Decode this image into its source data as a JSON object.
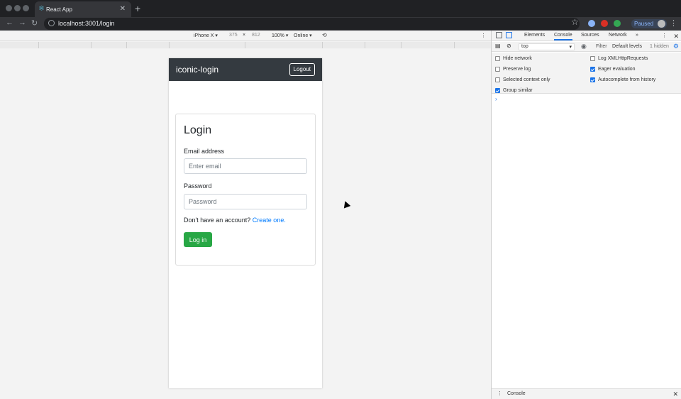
{
  "browser": {
    "tab_title": "React App",
    "tab_close": "✕",
    "new_tab": "+",
    "url": "localhost:3001/login",
    "back": "←",
    "forward": "→",
    "reload": "↻",
    "bookmark": "☆",
    "profile_label": "Paused",
    "menu": "⋮"
  },
  "device_toolbar": {
    "device": "iPhone X ▾",
    "width": "375",
    "times": "×",
    "height": "812",
    "zoom": "100% ▾",
    "network": "Online ▾",
    "more": "⋮"
  },
  "app": {
    "brand": "iconic-login",
    "logout_label": "Logout",
    "login_title": "Login",
    "email_label": "Email address",
    "email_placeholder": "Enter email",
    "password_label": "Password",
    "password_placeholder": "Password",
    "signup_text": "Don't have an account? ",
    "signup_link": "Create one.",
    "login_button": "Log in"
  },
  "devtools": {
    "tabs": [
      "Elements",
      "Console",
      "Sources",
      "Network"
    ],
    "more_tabs": "»",
    "context": "top",
    "context_arrow": "▾",
    "filter_placeholder": "Filter",
    "levels": "Default levels",
    "hidden_count": "1 hidden",
    "options_left": [
      {
        "label": "Hide network",
        "checked": false
      },
      {
        "label": "Preserve log",
        "checked": false
      },
      {
        "label": "Selected context only",
        "checked": false
      },
      {
        "label": "Group similar",
        "checked": true
      }
    ],
    "options_right": [
      {
        "label": "Log XMLHttpRequests",
        "checked": false
      },
      {
        "label": "Eager evaluation",
        "checked": true
      },
      {
        "label": "Autocomplete from history",
        "checked": true
      }
    ],
    "prompt": "›",
    "drawer_title": "Console",
    "close": "✕"
  },
  "colors": {
    "navbar": "#343a40",
    "login_button": "#28a745",
    "link": "#007bff",
    "devtools_accent": "#1a73e8"
  }
}
